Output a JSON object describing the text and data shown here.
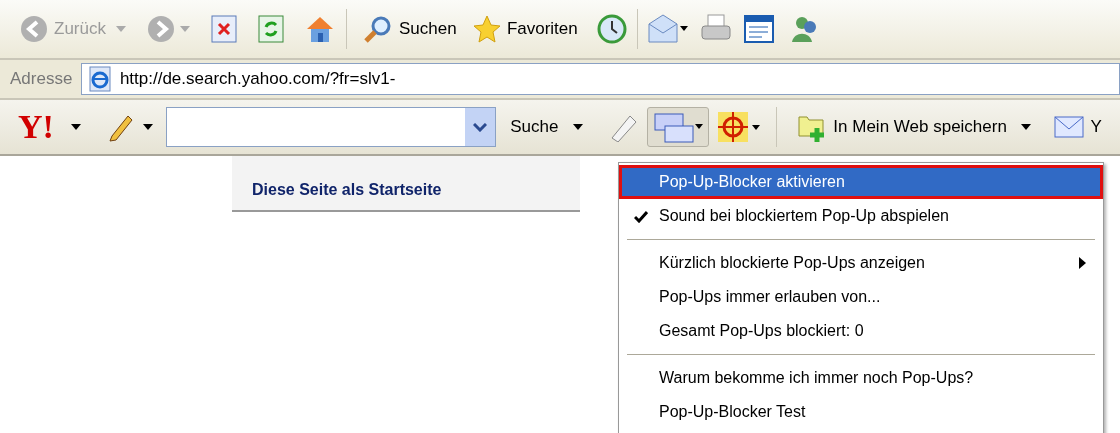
{
  "toolbar": {
    "back": "Zurück",
    "search": "Suchen",
    "favorites": "Favoriten"
  },
  "address": {
    "label": "Adresse",
    "url": "http://de.search.yahoo.com/?fr=slv1-"
  },
  "yahoo_toolbar": {
    "logo": "Y!",
    "search_button": "Suche",
    "popup_blocker_button": {
      "pressed": true
    },
    "save_button": "In Mein Web speichern",
    "mail_button": "Y"
  },
  "page": {
    "link": "Diese Seite als Startseite"
  },
  "popup_menu": {
    "items": [
      {
        "kind": "item",
        "label": "Pop-Up-Blocker aktivieren",
        "selected": true,
        "checked": false,
        "submenu": false
      },
      {
        "kind": "item",
        "label": "Sound bei blockiertem Pop-Up abspielen",
        "selected": false,
        "checked": true,
        "submenu": false
      },
      {
        "kind": "separator"
      },
      {
        "kind": "item",
        "label": "Kürzlich blockierte Pop-Ups anzeigen",
        "selected": false,
        "checked": false,
        "submenu": true
      },
      {
        "kind": "item",
        "label": "Pop-Ups immer erlauben von...",
        "selected": false,
        "checked": false,
        "submenu": false
      },
      {
        "kind": "item",
        "label": "Gesamt Pop-Ups blockiert: 0",
        "selected": false,
        "checked": false,
        "submenu": false
      },
      {
        "kind": "separator"
      },
      {
        "kind": "item",
        "label": "Warum bekomme ich immer noch Pop-Ups?",
        "selected": false,
        "checked": false,
        "submenu": false
      },
      {
        "kind": "item",
        "label": "Pop-Up-Blocker Test",
        "selected": false,
        "checked": false,
        "submenu": false
      }
    ]
  }
}
